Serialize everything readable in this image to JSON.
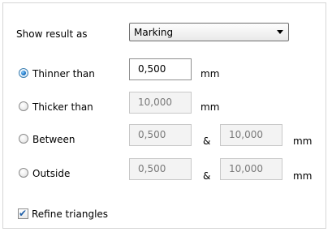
{
  "show_result": {
    "label": "Show result as",
    "selected": "Marking"
  },
  "options": [
    {
      "label": "Thinner than",
      "checked": true,
      "value": "0,500",
      "value2": null,
      "unit": "mm"
    },
    {
      "label": "Thicker than",
      "checked": false,
      "value": "10,000",
      "value2": null,
      "unit": "mm"
    },
    {
      "label": "Between",
      "checked": false,
      "value": "0,500",
      "value2": "10,000",
      "unit": "mm",
      "separator": "&"
    },
    {
      "label": "Outside",
      "checked": false,
      "value": "0,500",
      "value2": "10,000",
      "unit": "mm",
      "separator": "&"
    }
  ],
  "refine": {
    "label": "Refine triangles",
    "checked": true
  },
  "colors": {
    "accent": "#1e78c8",
    "disabled_text": "#7a7a7a",
    "border": "#8f8f8f"
  },
  "icons": {
    "dropdown_arrow": "chevron-down-icon",
    "check": "checkmark-icon"
  }
}
